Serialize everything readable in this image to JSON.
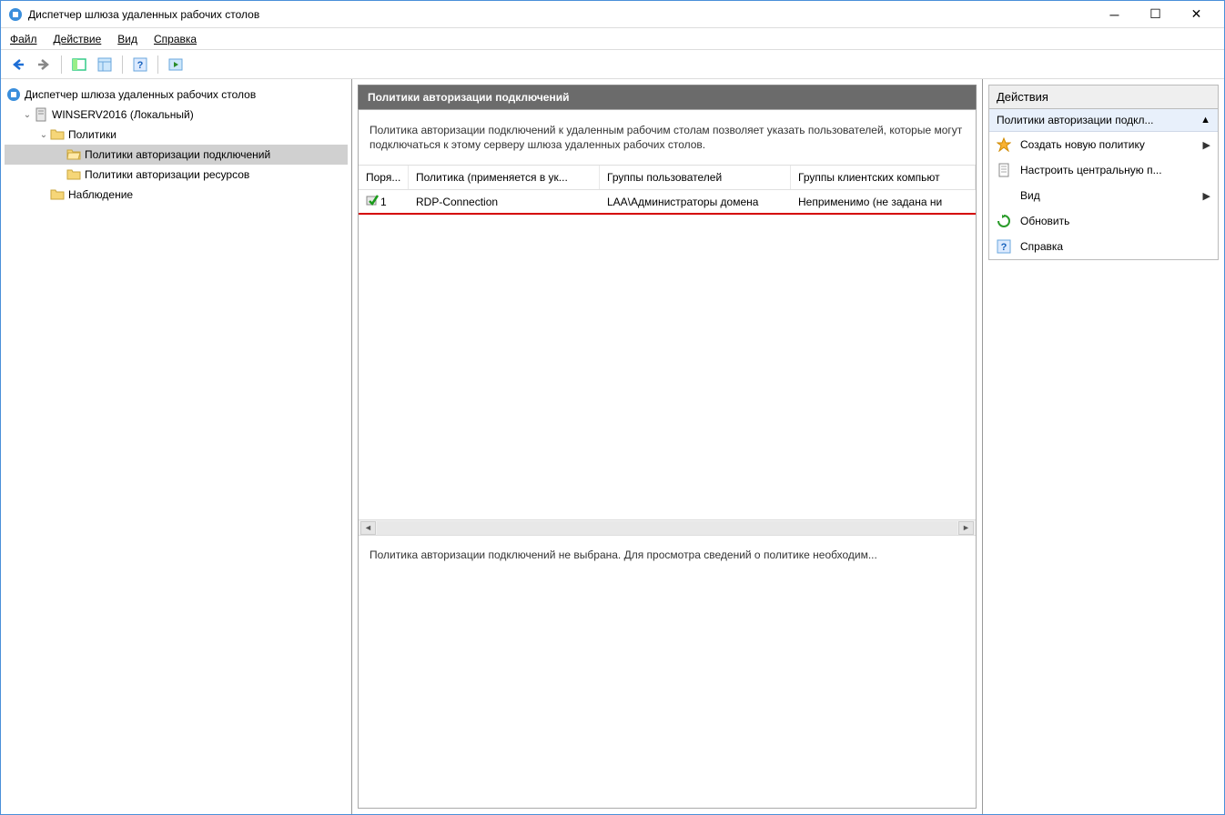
{
  "window": {
    "title": "Диспетчер шлюза удаленных рабочих столов"
  },
  "menu": {
    "file": "Файл",
    "action": "Действие",
    "view": "Вид",
    "help": "Справка"
  },
  "tree": {
    "root": "Диспетчер шлюза удаленных рабочих столов",
    "server": "WINSERV2016 (Локальный)",
    "policies": "Политики",
    "cap": "Политики авторизации подключений",
    "rap": "Политики авторизации ресурсов",
    "monitoring": "Наблюдение"
  },
  "main": {
    "header": "Политики авторизации подключений",
    "description": "Политика авторизации подключений к удаленным рабочим столам позволяет указать пользователей, которые могут подключаться к этому серверу шлюза удаленных рабочих столов.",
    "columns": {
      "order": "Поря...",
      "policy": "Политика (применяется в ук...",
      "users": "Группы пользователей",
      "clients": "Группы клиентских компьют"
    },
    "rows": [
      {
        "order": "1",
        "policy": "RDP-Connection",
        "users": "LAA\\Администраторы домена",
        "clients": "Неприменимо (не задана ни"
      }
    ],
    "status": "Политика авторизации подключений не выбрана. Для просмотра сведений о политике необходим..."
  },
  "actions": {
    "title": "Действия",
    "subtitle": "Политики авторизации подкл...",
    "items": {
      "create": "Создать новую политику",
      "central": "Настроить центральную п...",
      "view": "Вид",
      "refresh": "Обновить",
      "help": "Справка"
    }
  }
}
